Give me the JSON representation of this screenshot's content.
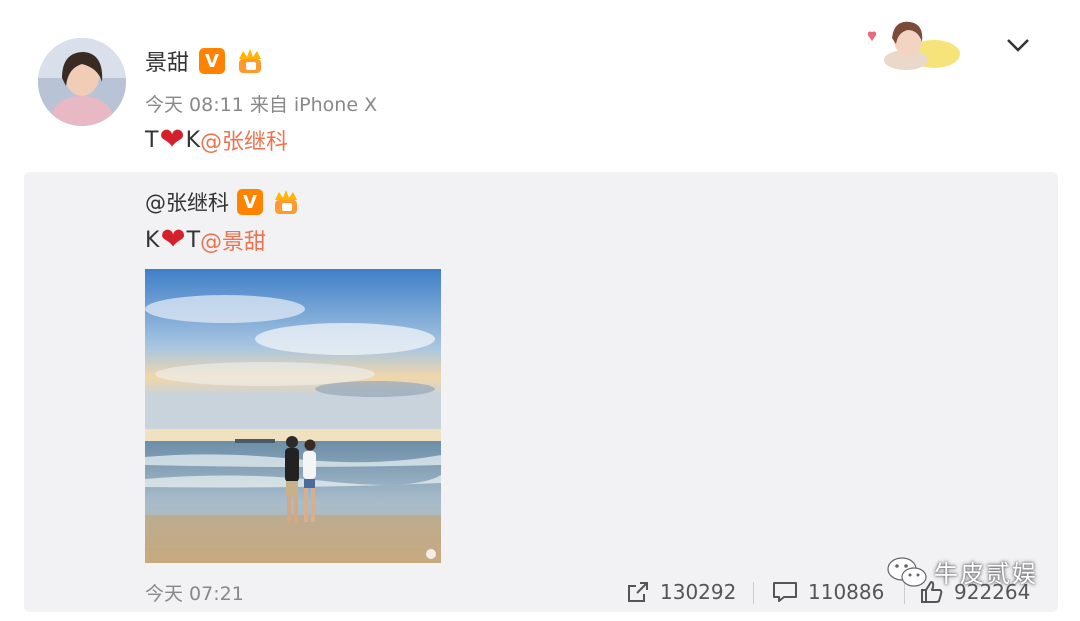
{
  "post": {
    "author": "景甜",
    "time": "今天 08:11",
    "source_prefix": "来自",
    "device": "iPhone X",
    "text_before": "T",
    "text_after": "K",
    "mention": "@张继科"
  },
  "repost": {
    "author": "@张继科",
    "text_before": "K",
    "text_after": "T",
    "mention": "@景甜",
    "time": "今天 07:21",
    "actions": {
      "forward_count": "130292",
      "comment_count": "110886",
      "like_count": "922264"
    }
  },
  "badges": {
    "verified_letter": "V"
  },
  "watermark": {
    "text": "牛皮贰娱"
  },
  "colors": {
    "accent": "#ff8200",
    "mention": "#eb7350",
    "heart": "#d3202a",
    "repost_bg": "#f2f2f5"
  }
}
